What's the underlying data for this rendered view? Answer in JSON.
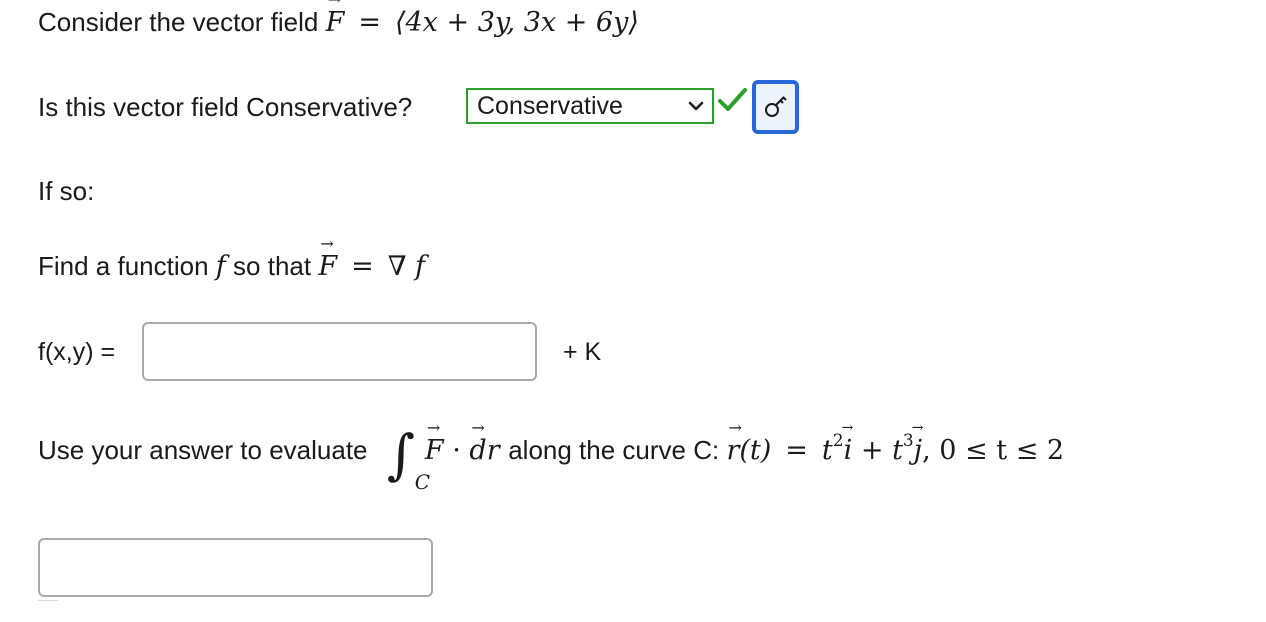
{
  "question": {
    "intro_text": "Consider the vector field",
    "field_name": "F",
    "equals": "=",
    "field_expr": "⟨4x + 3y, 3x + 6y⟩"
  },
  "conservative": {
    "prompt": "Is this vector field Conservative?",
    "selected_value": "Conservative",
    "status": "correct",
    "status_color": "#2aa02a",
    "key_icon": "key-icon"
  },
  "if_so": "If so:",
  "find_function": {
    "prefix": "Find a function",
    "f": "f",
    "middle": "so that",
    "field_name": "F",
    "equals": "=",
    "grad": "∇",
    "f2": "f"
  },
  "fxy": {
    "label": "f(x,y) =",
    "value": "",
    "suffix": "+ K"
  },
  "evaluate": {
    "prefix": "Use your answer to evaluate",
    "integral_symbol": "∫",
    "integral_subscript": "C",
    "F": "F",
    "dot": "·",
    "dr": "dr",
    "along": "along the curve C:",
    "r": "r",
    "t": "(t)",
    "equals": "=",
    "t2": "t",
    "exp2": "2",
    "i": "i",
    "plus": "+",
    "t3": "t",
    "exp3": "3",
    "j": "j",
    "range": ",  0 ≤ t ≤ 2"
  },
  "answer": {
    "value": ""
  }
}
